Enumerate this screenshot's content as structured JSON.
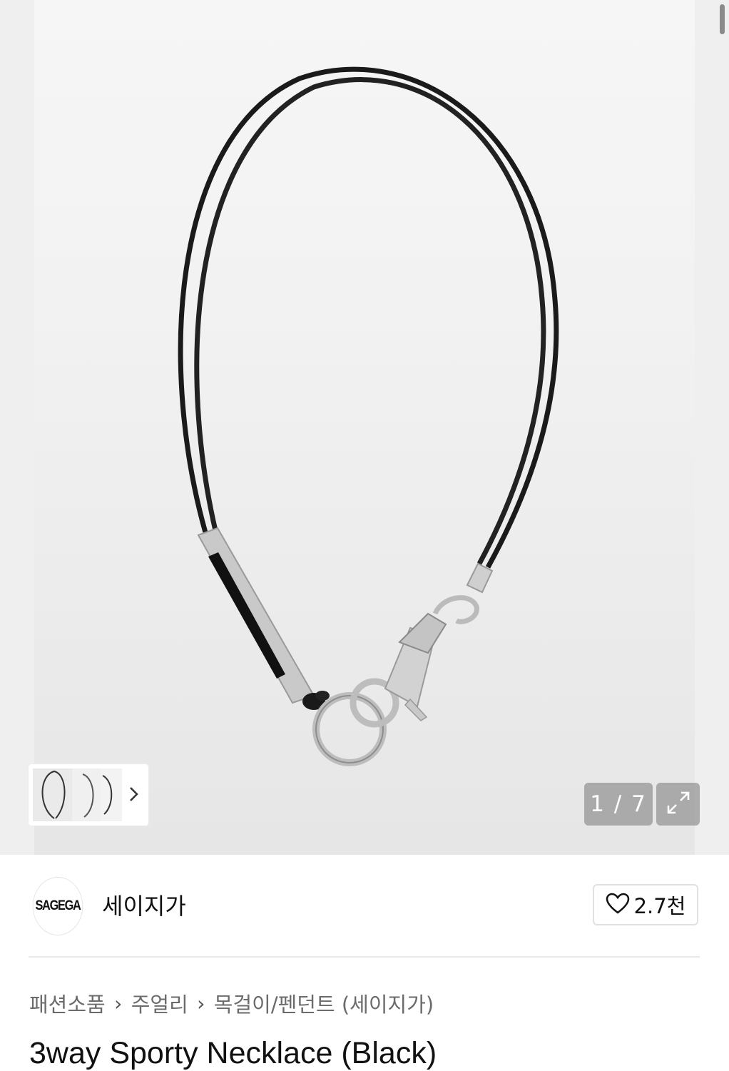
{
  "gallery": {
    "counter": "1 / 7",
    "expand_icon": "expand-arrows-icon",
    "thumbnails_next_icon": "chevron-right-icon"
  },
  "brand": {
    "logo_text": "SAGEGA",
    "name": "세이지가"
  },
  "like": {
    "icon": "heart-outline-icon",
    "count": "2.7천"
  },
  "breadcrumb": [
    "패션소품",
    "주얼리",
    "목걸이/펜던트 (세이지가)"
  ],
  "product": {
    "title": "3way Sporty Necklace (Black)"
  }
}
